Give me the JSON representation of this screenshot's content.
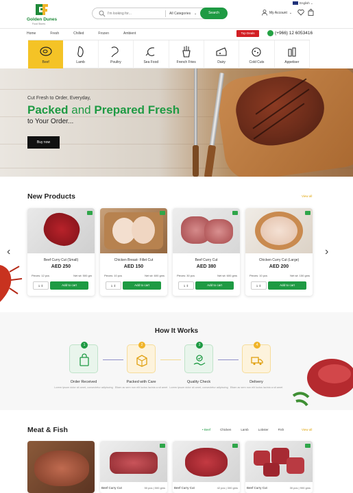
{
  "header": {
    "brand_name": "Golden Dunes",
    "brand_tagline": "Food Stores",
    "search_placeholder": "I'm looking for...",
    "category_select": "All Categories",
    "search_button": "Search",
    "language": "English",
    "account": "My Account"
  },
  "nav": {
    "items": [
      "Home",
      "Fresh",
      "Chilled",
      "Frozen",
      "Ambient"
    ],
    "deals": "Top Deals",
    "phone": "(+966) 12 6053416"
  },
  "categories": [
    {
      "label": "Beef",
      "icon": "steak-icon",
      "active": true
    },
    {
      "label": "Lamb",
      "icon": "lamb-leg-icon"
    },
    {
      "label": "Poultry",
      "icon": "chicken-leg-icon"
    },
    {
      "label": "Sea Food",
      "icon": "shrimp-icon"
    },
    {
      "label": "French Fries",
      "icon": "fries-icon"
    },
    {
      "label": "Dairy",
      "icon": "cheese-icon"
    },
    {
      "label": "Cold Cuts",
      "icon": "salami-icon"
    },
    {
      "label": "Appetiser",
      "icon": "bottles-icon"
    }
  ],
  "hero": {
    "line1": "Cut Fresh to Order, Everyday,",
    "line2a": "Packed",
    "line2b": " and ",
    "line2c": "Prepared Fresh",
    "line3": "to Your Order...",
    "button": "Buy now"
  },
  "new_products": {
    "title": "New Products",
    "view_all": "View all",
    "items": [
      {
        "name": "Beef Curry Cut (Small)",
        "price": "AED 250",
        "pieces": "Pieces: 12 pcs",
        "net": "Net wt: 500 gm",
        "qty": "1",
        "add": "Add to cart"
      },
      {
        "name": "Chicken Breast- Fillet Cut",
        "price": "AED 150",
        "pieces": "Pieces: 10 pcs",
        "net": "Net wt: 600 gms",
        "qty": "1",
        "add": "Add to cart"
      },
      {
        "name": "Beef Curry Cut",
        "price": "AED 380",
        "pieces": "Pieces: 30 pcs",
        "net": "Net wt: 600 gms",
        "qty": "1",
        "add": "Add to cart"
      },
      {
        "name": "Chicken Curry Cut (Large)",
        "price": "AED 200",
        "pieces": "Pieces: 10 pcs",
        "net": "Net wt: 150 gms",
        "qty": "1",
        "add": "Add to cart"
      }
    ]
  },
  "how": {
    "title": "How It Works",
    "steps": [
      {
        "num": "1",
        "title": "Order Received",
        "desc": "Lorem ipsum dolor sit amet, consectetur adipiscing",
        "color": "#1e9a43",
        "bg": "#e9f5ec",
        "icon": "order-bag-icon"
      },
      {
        "num": "2",
        "title": "Packed with Care",
        "desc": "Etiam ac sem non elit luctus lacinia a sit amet",
        "color": "#f0b429",
        "bg": "#fdf3dc",
        "icon": "packing-box-icon"
      },
      {
        "num": "3",
        "title": "Quality Check",
        "desc": "Lorem ipsum dolor sit amet, consectetur adipiscing",
        "color": "#1e9a43",
        "bg": "#e9f5ec",
        "icon": "quality-hand-icon"
      },
      {
        "num": "4",
        "title": "Delivery",
        "desc": "Etiam ac sem non elit luctus lacinia a sit amet",
        "color": "#f0b429",
        "bg": "#fdf3dc",
        "icon": "delivery-truck-icon"
      }
    ]
  },
  "meat_fish": {
    "title": "Meat & Fish",
    "tabs": [
      "• Beef",
      "Chicken",
      "Lamb",
      "Lobster",
      "Fish"
    ],
    "view_all": "View all",
    "cards": [
      {
        "name": "",
        "meta": ""
      },
      {
        "name": "Beef Curry Cut",
        "meta": "50 pcs | 500 gms"
      },
      {
        "name": "Beef Curry Cut",
        "meta": "42 pcs | 300 gms"
      },
      {
        "name": "Beef Curry Cut",
        "meta": "30 pcs | 900 gms"
      }
    ]
  },
  "colors": {
    "brand_green": "#1e9a43",
    "accent_yellow": "#f4c326",
    "deal_red": "#d21f24"
  }
}
